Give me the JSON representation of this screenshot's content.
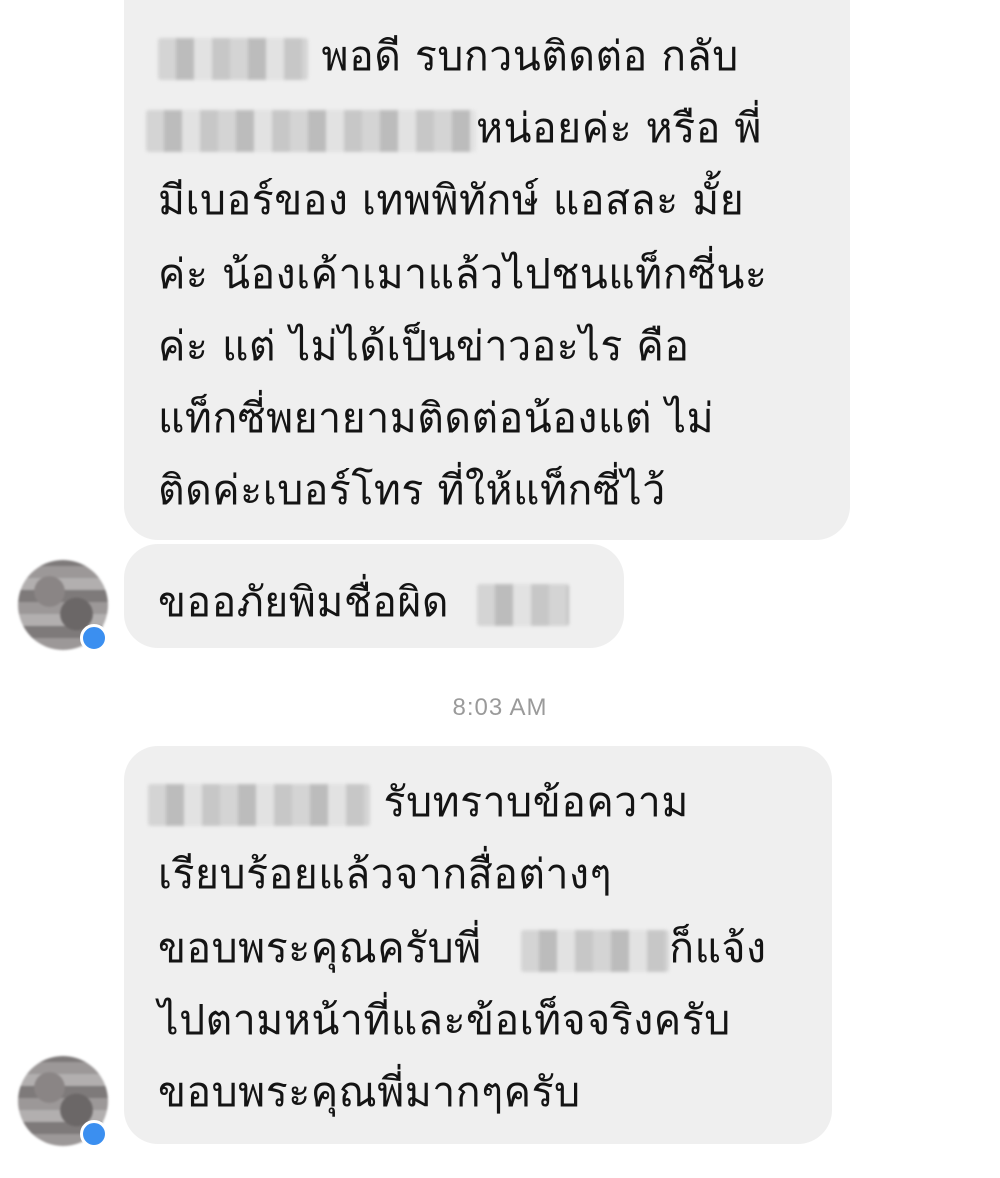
{
  "messages": [
    {
      "lines": [
        {
          "after": "พอดี  รบกวนติดต่อ กลับ"
        },
        {
          "after": "หน่อยค่ะ  หรือ  พี่"
        },
        {
          "text": "มีเบอร์ของ  เทพพิทักษ์ แอสละ มั้ย"
        },
        {
          "text": "ค่ะ  น้องเค้าเมาแล้วไปชนแท็กซี่นะ"
        },
        {
          "text": "ค่ะ  แต่ ไม่ได้เป็นข่าวอะไร คือ"
        },
        {
          "text": "แท็กซี่พยายามติดต่อน้องแต่  ไม่"
        },
        {
          "text": "ติดค่ะเบอร์โทร ที่ให้แท็กซี่ไว้"
        }
      ]
    },
    {
      "lines": [
        {
          "before": "ขออภัยพิมชื่อผิด"
        }
      ]
    },
    {
      "lines": [
        {
          "after": "รับทราบข้อความ"
        },
        {
          "text": "เรียบร้อยแล้วจากสื่อต่างๆ"
        },
        {
          "before": "ขอบพระคุณครับพี่",
          "after": "ก็แจ้ง"
        },
        {
          "text": "ไปตามหน้าที่และข้อเท็จจริงครับ"
        },
        {
          "text": "ขอบพระคุณพี่มากๆครับ"
        }
      ]
    }
  ],
  "timestamp": "8:03 AM",
  "colors": {
    "bubble": "#efefef",
    "text": "#141414",
    "timestamp": "#9a9a9a",
    "badge": "#3b8ff0"
  }
}
